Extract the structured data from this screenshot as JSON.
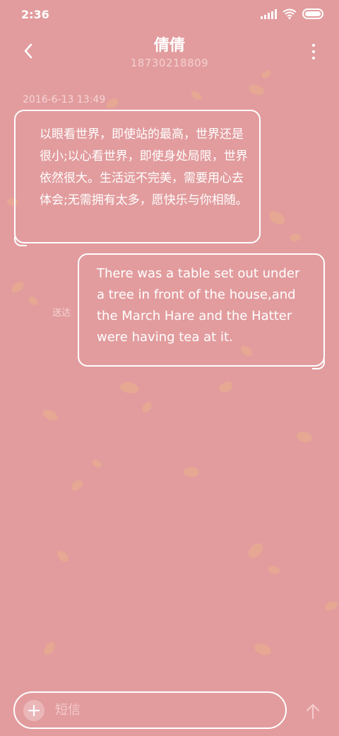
{
  "status_bar": {
    "time": "2:36"
  },
  "header": {
    "contact_name": "倩倩",
    "contact_number": "18730218809"
  },
  "conversation": {
    "timestamp": "2016-6-13 13:49",
    "messages": [
      {
        "direction": "incoming",
        "text": "以眼看世界，即使站的最高，世界还是很小;以心看世界，即使身处局限，世界依然很大。生活远不完美，需要用心去体会;无需拥有太多，愿快乐与你相随。"
      },
      {
        "direction": "outgoing",
        "text": "There was a table set out under a tree in front of the house,and the March Hare and the Hatter were having tea at it.",
        "status": "送达"
      }
    ]
  },
  "composer": {
    "placeholder": "短信"
  },
  "icons": {
    "back": "chevron-left-icon",
    "more": "more-vertical-icon",
    "add": "plus-icon",
    "send": "arrow-up-icon"
  },
  "colors": {
    "background": "#e29c9e",
    "pattern": "#e9b08a",
    "foreground": "#ffffff"
  }
}
